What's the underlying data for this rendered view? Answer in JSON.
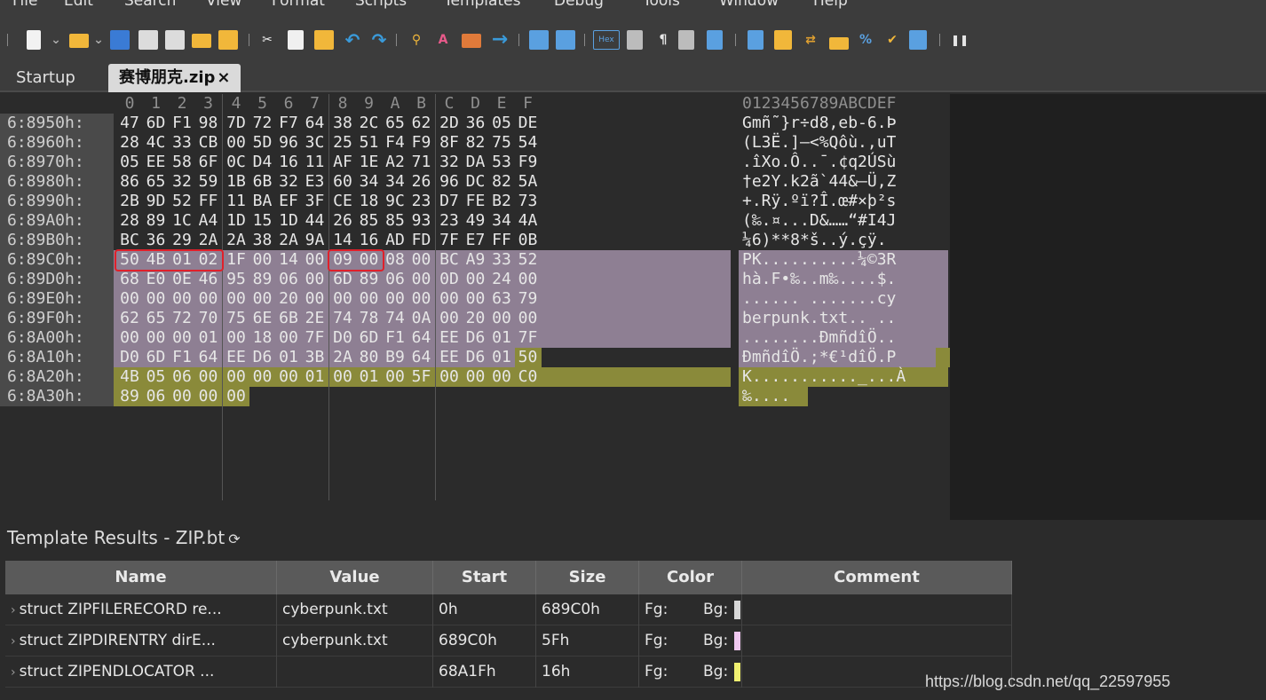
{
  "menu": [
    "File",
    "Edit",
    "Search",
    "View",
    "Format",
    "Scripts",
    "Templates",
    "Debug",
    "Tools",
    "Window",
    "Help"
  ],
  "toolbar": {
    "hex_label": "Hex",
    "icons": [
      "new-file-icon",
      "open-folder-icon",
      "save-icon",
      "save-as-icon",
      "save-all-icon",
      "open-workspace-icon",
      "folder-tree-icon",
      "cut-icon",
      "copy-icon",
      "paste-icon",
      "undo-icon",
      "redo-icon",
      "find-icon",
      "replace-icon",
      "goto-icon",
      "arrow-right-icon",
      "bookmark-icon",
      "bookmark-list-icon",
      "hex-mode-icon",
      "column-mode-icon",
      "pilcrow-icon",
      "list-icon",
      "highlight-icon",
      "calculator-icon",
      "compare-icon",
      "swap-icon",
      "histogram-icon",
      "percent-icon",
      "checksum-icon",
      "base-convert-icon",
      "more-icon"
    ]
  },
  "tabs": [
    {
      "label": "Startup"
    },
    {
      "label": "赛博朋克.zip",
      "close": "×"
    }
  ],
  "hex": {
    "columns": [
      "0",
      "1",
      "2",
      "3",
      "4",
      "5",
      "6",
      "7",
      "8",
      "9",
      "A",
      "B",
      "C",
      "D",
      "E",
      "F"
    ],
    "char_header": "0123456789ABCDEF",
    "rows": [
      {
        "addr": "6:8950h:",
        "bytes": [
          "47",
          "6D",
          "F1",
          "98",
          "7D",
          "72",
          "F7",
          "64",
          "38",
          "2C",
          "65",
          "62",
          "2D",
          "36",
          "05",
          "DE"
        ],
        "text": "Gmñ˜}r÷d8,eb-6.Þ"
      },
      {
        "addr": "6:8960h:",
        "bytes": [
          "28",
          "4C",
          "33",
          "CB",
          "00",
          "5D",
          "96",
          "3C",
          "25",
          "51",
          "F4",
          "F9",
          "8F",
          "82",
          "75",
          "54"
        ],
        "text": "(L3Ë.]–<%Qôù.‚uT"
      },
      {
        "addr": "6:8970h:",
        "bytes": [
          "05",
          "EE",
          "58",
          "6F",
          "0C",
          "D4",
          "16",
          "11",
          "AF",
          "1E",
          "A2",
          "71",
          "32",
          "DA",
          "53",
          "F9"
        ],
        "text": ".îXo.Ô..¯.¢q2ÚSù"
      },
      {
        "addr": "6:8980h:",
        "bytes": [
          "86",
          "65",
          "32",
          "59",
          "1B",
          "6B",
          "32",
          "E3",
          "60",
          "34",
          "34",
          "26",
          "96",
          "DC",
          "82",
          "5A"
        ],
        "text": "†e2Y.k2ã`44&–Ü‚Z"
      },
      {
        "addr": "6:8990h:",
        "bytes": [
          "2B",
          "9D",
          "52",
          "FF",
          "11",
          "BA",
          "EF",
          "3F",
          "CE",
          "18",
          "9C",
          "23",
          "D7",
          "FE",
          "B2",
          "73"
        ],
        "text": "+.Rÿ.ºï?Î.œ#×þ²s"
      },
      {
        "addr": "6:89A0h:",
        "bytes": [
          "28",
          "89",
          "1C",
          "A4",
          "1D",
          "15",
          "1D",
          "44",
          "26",
          "85",
          "85",
          "93",
          "23",
          "49",
          "34",
          "4A"
        ],
        "text": "(‰.¤...D&……“#I4J"
      },
      {
        "addr": "6:89B0h:",
        "bytes": [
          "BC",
          "36",
          "29",
          "2A",
          "2A",
          "38",
          "2A",
          "9A",
          "14",
          "16",
          "AD",
          "FD",
          "7F",
          "E7",
          "FF",
          "0B"
        ],
        "text": "¼6)**8*š..­ý.çÿ."
      },
      {
        "addr": "6:89C0h:",
        "bytes": [
          "50",
          "4B",
          "01",
          "02",
          "1F",
          "00",
          "14",
          "00",
          "09",
          "00",
          "08",
          "00",
          "BC",
          "A9",
          "33",
          "52"
        ],
        "text": "PK..........¼©3R"
      },
      {
        "addr": "6:89D0h:",
        "bytes": [
          "68",
          "E0",
          "0E",
          "46",
          "95",
          "89",
          "06",
          "00",
          "6D",
          "89",
          "06",
          "00",
          "0D",
          "00",
          "24",
          "00"
        ],
        "text": "hà.F•‰..m‰....$."
      },
      {
        "addr": "6:89E0h:",
        "bytes": [
          "00",
          "00",
          "00",
          "00",
          "00",
          "00",
          "20",
          "00",
          "00",
          "00",
          "00",
          "00",
          "00",
          "00",
          "63",
          "79"
        ],
        "text": "...... .......cy"
      },
      {
        "addr": "6:89F0h:",
        "bytes": [
          "62",
          "65",
          "72",
          "70",
          "75",
          "6E",
          "6B",
          "2E",
          "74",
          "78",
          "74",
          "0A",
          "00",
          "20",
          "00",
          "00"
        ],
        "text": "berpunk.txt.. .."
      },
      {
        "addr": "6:8A00h:",
        "bytes": [
          "00",
          "00",
          "00",
          "01",
          "00",
          "18",
          "00",
          "7F",
          "D0",
          "6D",
          "F1",
          "64",
          "EE",
          "D6",
          "01",
          "7F"
        ],
        "text": "........ÐmñdîÖ.."
      },
      {
        "addr": "6:8A10h:",
        "bytes": [
          "D0",
          "6D",
          "F1",
          "64",
          "EE",
          "D6",
          "01",
          "3B",
          "2A",
          "80",
          "B9",
          "64",
          "EE",
          "D6",
          "01",
          "50"
        ],
        "text": "ÐmñdîÖ.;*€¹dîÖ.P"
      },
      {
        "addr": "6:8A20h:",
        "bytes": [
          "4B",
          "05",
          "06",
          "00",
          "00",
          "00",
          "00",
          "01",
          "00",
          "01",
          "00",
          "5F",
          "00",
          "00",
          "00",
          "C0"
        ],
        "text": "K..........._...À"
      },
      {
        "addr": "6:8A30h:",
        "bytes": [
          "89",
          "06",
          "00",
          "00",
          "00"
        ],
        "text": "‰...."
      }
    ]
  },
  "template_results": {
    "title": "Template Results - ZIP.bt",
    "refresh_icon": "⟳",
    "headers": [
      "Name",
      "Value",
      "Start",
      "Size",
      "Color",
      "Comment"
    ],
    "rows": [
      {
        "name": "struct ZIPFILERECORD re...",
        "value": "cyberpunk.txt",
        "start": "0h",
        "size": "689C0h",
        "fg": "Fg:",
        "bg": "Bg:",
        "bg_color": "#d8d8d8"
      },
      {
        "name": "struct ZIPDIRENTRY dirE...",
        "value": "cyberpunk.txt",
        "start": "689C0h",
        "size": "5Fh",
        "fg": "Fg:",
        "bg": "Bg:",
        "bg_color": "#f0c8f0"
      },
      {
        "name": "struct ZIPENDLOCATOR ...",
        "value": "",
        "start": "68A1Fh",
        "size": "16h",
        "fg": "Fg:",
        "bg": "Bg:",
        "bg_color": "#f0f070"
      }
    ]
  },
  "watermark": "https://blog.csdn.net/qq_22597955",
  "colors": {
    "background": "#2b2b2b",
    "dir_entry_highlight": "#8e7f93",
    "end_locator_highlight": "#8a8a3a",
    "marker_box": "#e0202a"
  }
}
